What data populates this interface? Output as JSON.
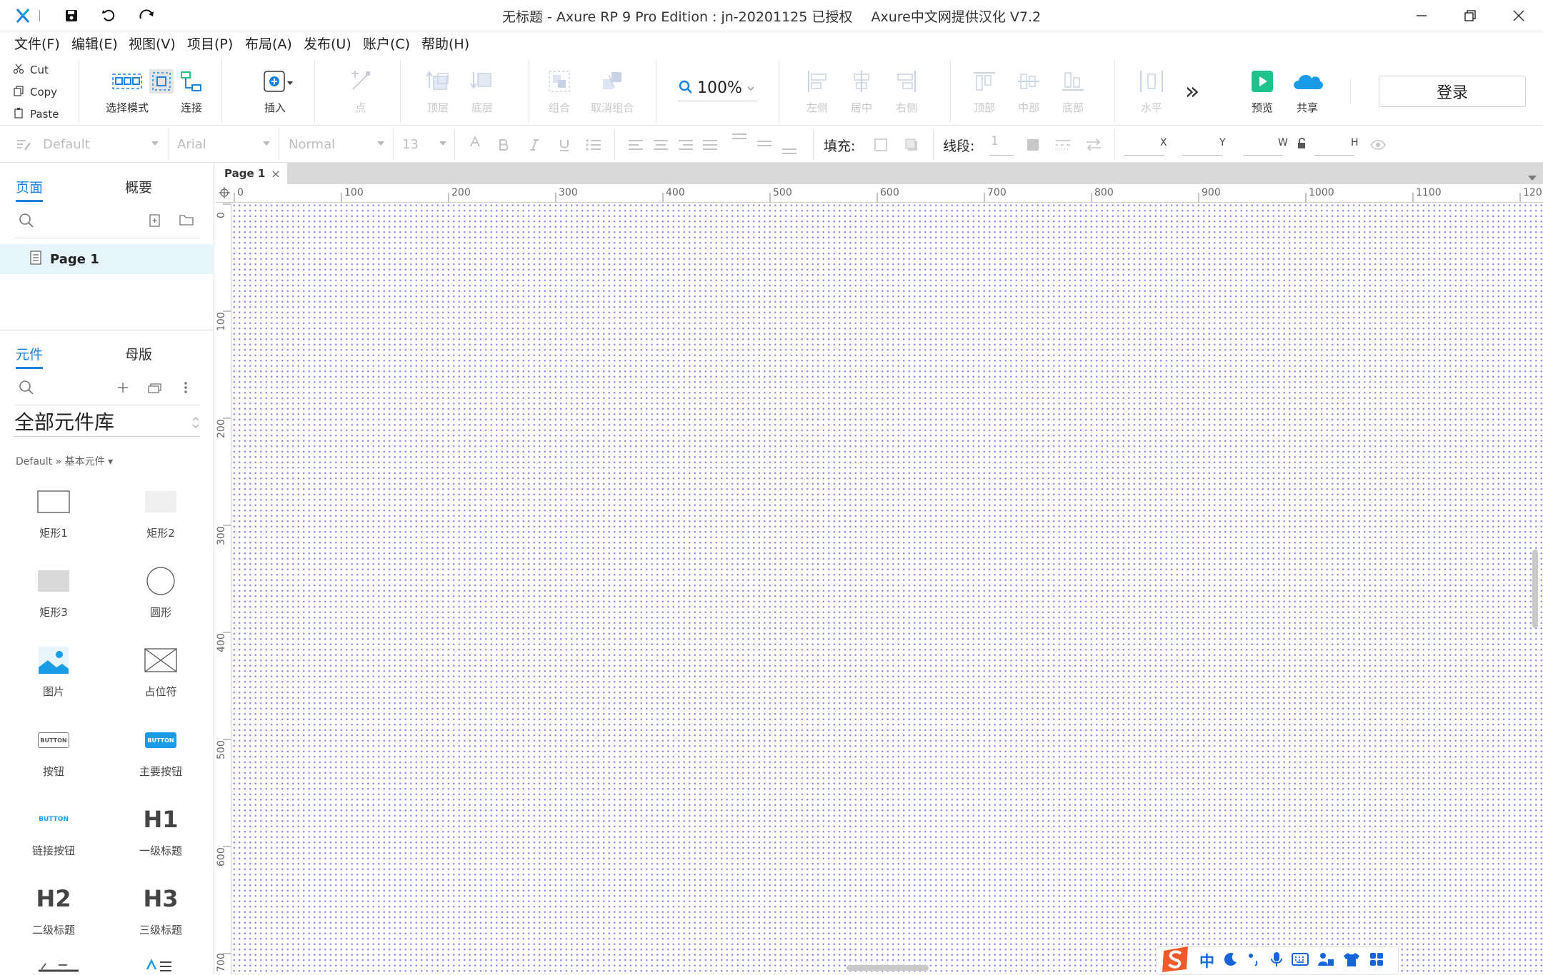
{
  "window": {
    "title_main": "无标题 - Axure RP 9 Pro Edition : jn-20201125 已授权",
    "title_extra": "Axure中文网提供汉化 V7.2"
  },
  "menu": [
    "文件(F)",
    "编辑(E)",
    "视图(V)",
    "项目(P)",
    "布局(A)",
    "发布(U)",
    "账户(C)",
    "帮助(H)"
  ],
  "clipboard": {
    "cut": "Cut",
    "copy": "Copy",
    "paste": "Paste"
  },
  "toolbar": {
    "select_mode": "选择模式",
    "connect": "连接",
    "insert": "插入",
    "point": "点",
    "top_layer": "顶层",
    "bottom_layer": "底层",
    "group": "组合",
    "ungroup": "取消组合",
    "zoom": "100%",
    "align_left": "左侧",
    "align_center": "居中",
    "align_right": "右侧",
    "align_top": "顶部",
    "align_middle": "中部",
    "align_bottom": "底部",
    "distribute_h": "水平",
    "more": "»",
    "preview": "预览",
    "share": "共享",
    "login": "登录"
  },
  "format": {
    "style": "Default",
    "font": "Arial",
    "weight": "Normal",
    "size": "13",
    "fill_label": "填充:",
    "stroke_label": "线段:",
    "stroke_value": "1",
    "x_label": "X",
    "y_label": "Y",
    "w_label": "W",
    "h_label": "H"
  },
  "pages_panel": {
    "tab_pages": "页面",
    "tab_outline": "概要",
    "page_name": "Page 1"
  },
  "widgets_panel": {
    "tab_widgets": "元件",
    "tab_masters": "母版",
    "library": "全部元件库",
    "breadcrumb": "Default » 基本元件 ▾",
    "items": [
      "矩形1",
      "矩形2",
      "矩形3",
      "圆形",
      "图片",
      "占位符",
      "按钮",
      "主要按钮",
      "链接按钮",
      "一级标题",
      "二级标题",
      "三级标题"
    ],
    "button_text": "BUTTON",
    "h1_text": "H1",
    "h2_text": "H2",
    "h3_text": "H3"
  },
  "canvas": {
    "tab_label": "Page 1",
    "h_ticks": [
      "0",
      "100",
      "200",
      "300",
      "400",
      "500",
      "600",
      "700",
      "800",
      "900",
      "1000",
      "1100",
      "120"
    ],
    "v_ticks": [
      "0",
      "100",
      "200",
      "300",
      "400",
      "500",
      "600",
      "700"
    ]
  },
  "ime": {
    "lang": "中"
  },
  "colors": {
    "accent": "#1a83e0",
    "grid_dot": "#8c8cf0",
    "selected_page_bg": "#e6f4fb",
    "preview_green": "#1ec28b"
  }
}
